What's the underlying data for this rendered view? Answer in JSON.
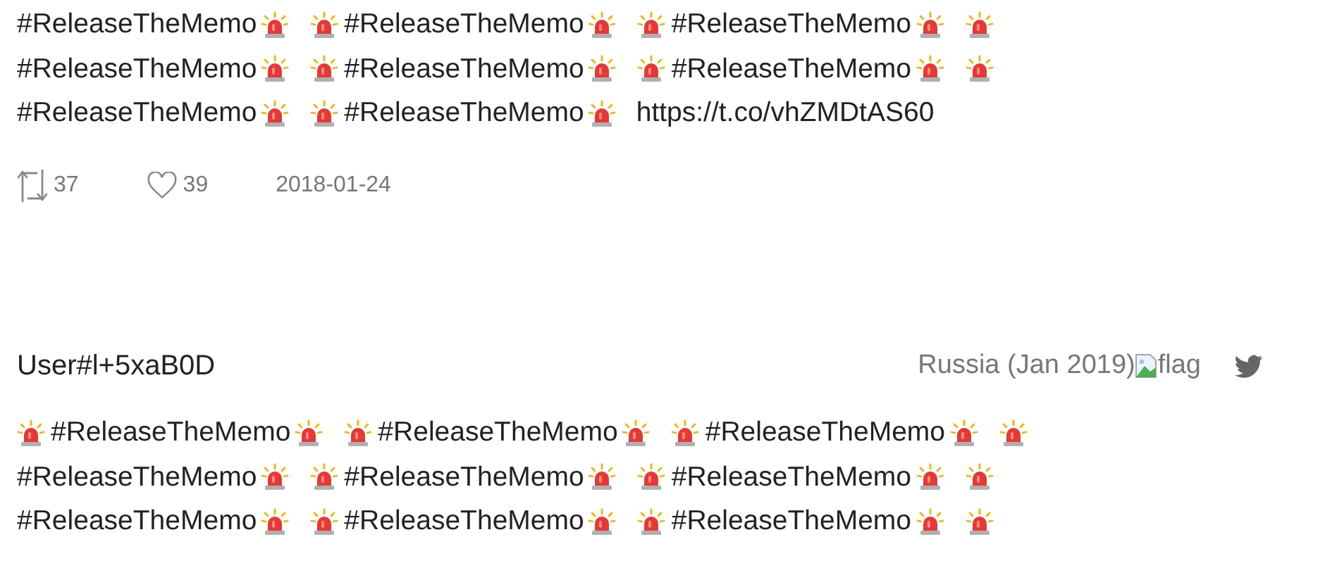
{
  "tweets": [
    {
      "lines": [
        [
          {
            "kind": "hashtag",
            "text": "#ReleaseTheMemo"
          },
          {
            "kind": "siren"
          },
          {
            "kind": "siren"
          },
          {
            "kind": "hashtag",
            "text": "#ReleaseTheMemo"
          },
          {
            "kind": "siren"
          },
          {
            "kind": "siren"
          },
          {
            "kind": "hashtag",
            "text": "#ReleaseTheMemo"
          },
          {
            "kind": "siren"
          },
          {
            "kind": "siren"
          }
        ],
        [
          {
            "kind": "hashtag",
            "text": "#ReleaseTheMemo"
          },
          {
            "kind": "siren"
          },
          {
            "kind": "siren"
          },
          {
            "kind": "hashtag",
            "text": "#ReleaseTheMemo"
          },
          {
            "kind": "siren"
          },
          {
            "kind": "siren"
          },
          {
            "kind": "hashtag",
            "text": "#ReleaseTheMemo"
          },
          {
            "kind": "siren"
          },
          {
            "kind": "siren"
          }
        ],
        [
          {
            "kind": "hashtag",
            "text": "#ReleaseTheMemo"
          },
          {
            "kind": "siren"
          },
          {
            "kind": "siren"
          },
          {
            "kind": "hashtag",
            "text": "#ReleaseTheMemo"
          },
          {
            "kind": "siren"
          },
          {
            "kind": "link",
            "text": "https://t.co/vhZMDtAS60"
          }
        ]
      ],
      "retweets": "37",
      "likes": "39",
      "date": "2018-01-24"
    },
    {
      "user": "User#l+5xaB0D",
      "location": "Russia (Jan 2019)",
      "flag_alt": "flag",
      "lines": [
        [
          {
            "kind": "siren"
          },
          {
            "kind": "hashtag",
            "text": "#ReleaseTheMemo"
          },
          {
            "kind": "siren"
          },
          {
            "kind": "siren"
          },
          {
            "kind": "hashtag",
            "text": "#ReleaseTheMemo"
          },
          {
            "kind": "siren"
          },
          {
            "kind": "siren"
          },
          {
            "kind": "hashtag",
            "text": "#ReleaseTheMemo"
          },
          {
            "kind": "siren"
          },
          {
            "kind": "siren"
          }
        ],
        [
          {
            "kind": "hashtag",
            "text": "#ReleaseTheMemo"
          },
          {
            "kind": "siren"
          },
          {
            "kind": "siren"
          },
          {
            "kind": "hashtag",
            "text": "#ReleaseTheMemo"
          },
          {
            "kind": "siren"
          },
          {
            "kind": "siren"
          },
          {
            "kind": "hashtag",
            "text": "#ReleaseTheMemo"
          },
          {
            "kind": "siren"
          },
          {
            "kind": "siren"
          }
        ],
        [
          {
            "kind": "hashtag",
            "text": "#ReleaseTheMemo"
          },
          {
            "kind": "siren"
          },
          {
            "kind": "siren"
          },
          {
            "kind": "hashtag",
            "text": "#ReleaseTheMemo"
          },
          {
            "kind": "siren"
          },
          {
            "kind": "siren"
          },
          {
            "kind": "hashtag",
            "text": "#ReleaseTheMemo"
          },
          {
            "kind": "siren"
          },
          {
            "kind": "siren"
          }
        ]
      ]
    }
  ]
}
